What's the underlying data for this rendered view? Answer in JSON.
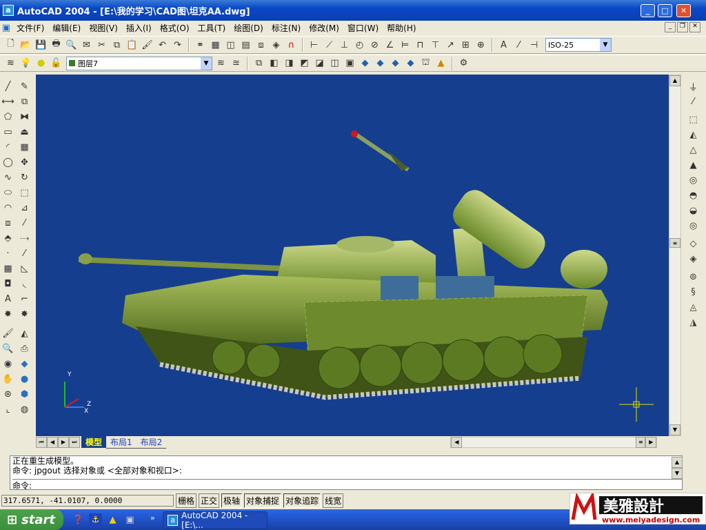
{
  "window": {
    "title": "AutoCAD 2004 - [E:\\我的学习\\CAD图\\坦克AA.dwg]",
    "app_icon": "a"
  },
  "menu": [
    "文件(F)",
    "编辑(E)",
    "视图(V)",
    "插入(I)",
    "格式(O)",
    "工具(T)",
    "绘图(D)",
    "标注(N)",
    "修改(M)",
    "窗口(W)",
    "帮助(H)"
  ],
  "toolbar": {
    "dimstyle": "ISO-25",
    "layer": "图层7"
  },
  "layout_tabs": [
    "模型",
    "布局1",
    "布局2"
  ],
  "ucs": {
    "x": "X",
    "y": "Y",
    "z": "Z"
  },
  "command": {
    "lines": [
      "正在重生成模型。",
      "命令:  jpgout 选择对象或 <全部对象和视口>:"
    ],
    "prompt": "命令:"
  },
  "status": {
    "coords": "317.6571, -41.0107, 0.0000",
    "toggles": [
      {
        "label": "栅格",
        "on": false
      },
      {
        "label": "正交",
        "on": false
      },
      {
        "label": "极轴",
        "on": true
      },
      {
        "label": "对象捕捉",
        "on": true
      },
      {
        "label": "对象追踪",
        "on": true
      },
      {
        "label": "线宽",
        "on": false
      }
    ]
  },
  "taskbar": {
    "start": "start",
    "task": "AutoCAD 2004 - [E:\\..."
  },
  "watermark": {
    "brand": "美雅設計",
    "url": "www.meiyadesign.com"
  },
  "colors": {
    "viewport": "#163e8e",
    "tank": "#7c9a3a",
    "title": "#0a47c8"
  }
}
